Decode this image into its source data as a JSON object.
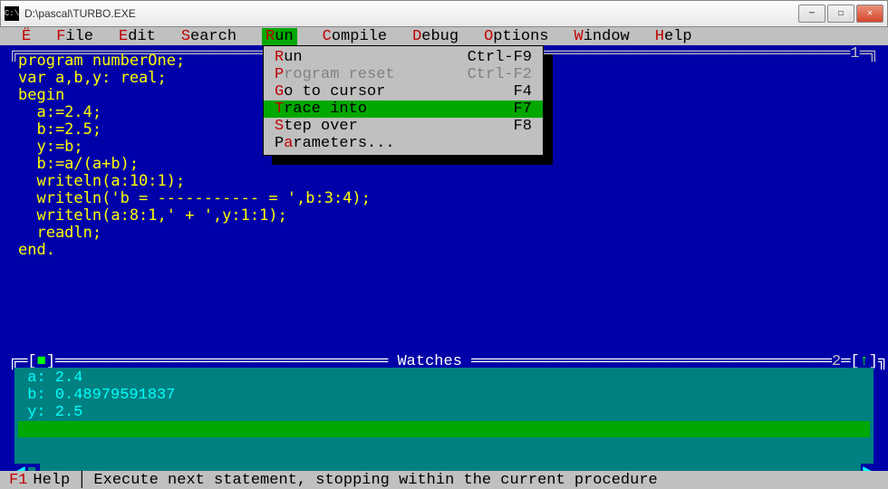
{
  "window": {
    "title": "D:\\pascal\\TURBO.EXE"
  },
  "menubar": {
    "items": [
      {
        "hot": "Ë",
        "rest": ""
      },
      {
        "hot": "F",
        "rest": "ile"
      },
      {
        "hot": "E",
        "rest": "dit"
      },
      {
        "hot": "S",
        "rest": "earch"
      },
      {
        "hot": "R",
        "rest": "un",
        "active": true
      },
      {
        "hot": "C",
        "rest": "ompile"
      },
      {
        "hot": "D",
        "rest": "ebug"
      },
      {
        "hot": "O",
        "rest": "ptions"
      },
      {
        "hot": "W",
        "rest": "indow"
      },
      {
        "hot": "H",
        "rest": "elp"
      }
    ]
  },
  "dropdown": {
    "items": [
      {
        "hot": "R",
        "label": "un",
        "shortcut": "Ctrl-F9",
        "disabled": false,
        "selected": false
      },
      {
        "hot": "P",
        "label": "rogram reset",
        "shortcut": "Ctrl-F2",
        "disabled": true,
        "selected": false
      },
      {
        "hot": "G",
        "label": "o to cursor",
        "shortcut": "F4",
        "disabled": false,
        "selected": false
      },
      {
        "hot": "T",
        "label": "race into",
        "shortcut": "F7",
        "disabled": false,
        "selected": true
      },
      {
        "hot": "S",
        "label": "tep over",
        "shortcut": "F8",
        "disabled": false,
        "selected": false
      },
      {
        "hot": "P",
        "label": "",
        "label2": "rameters...",
        "shortcut": "",
        "disabled": false,
        "selected": false,
        "hot2": "a",
        "pre": "P"
      }
    ]
  },
  "editor": {
    "frame_number": "1",
    "code": "program numberOne;\nvar a,b,y: real;\nbegin\n  a:=2.4;\n  b:=2.5;\n  y:=b;\n  b:=a/(a+b);\n  writeln(a:10:1);\n  writeln('b = ----------- = ',b:3:4);\n  writeln(a:8:1,' + ',y:1:1);\n  readln;\nend."
  },
  "watches": {
    "title": "Watches",
    "frame_number": "2",
    "lines": [
      "a: 2.4",
      "b: 0.48979591837",
      "y: 2.5"
    ]
  },
  "status": {
    "key": "F1",
    "keylabel": "Help",
    "hint": "Execute next statement, stopping within the current procedure"
  }
}
